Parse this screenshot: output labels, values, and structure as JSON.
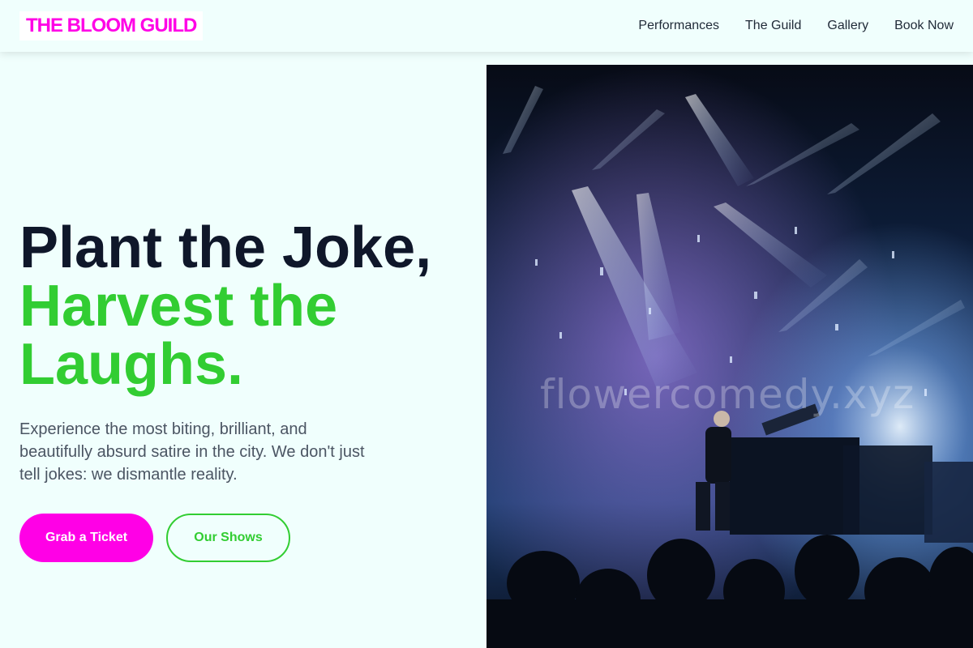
{
  "brand": {
    "logo_text": "THE BLOOM GUILD"
  },
  "nav": {
    "items": [
      {
        "label": "Performances"
      },
      {
        "label": "The Guild"
      },
      {
        "label": "Gallery"
      },
      {
        "label": "Book Now"
      }
    ]
  },
  "hero": {
    "headline_line1": "Plant the Joke,",
    "headline_line2": "Harvest the",
    "headline_line3": "Laughs.",
    "lead": "Experience the most biting, brilliant, and beautifully absurd satire in the city. We don't just tell jokes: we dismantle reality.",
    "primary_cta": "Grab a Ticket",
    "secondary_cta": "Our Shows",
    "image_watermark": "flowercomedy.xyz",
    "image_subject": "concert-stage-photo"
  },
  "colors": {
    "accent_pink": "#ff00e6",
    "accent_green": "#32cd32",
    "background": "#f0fffd",
    "headline": "#0f172a"
  }
}
